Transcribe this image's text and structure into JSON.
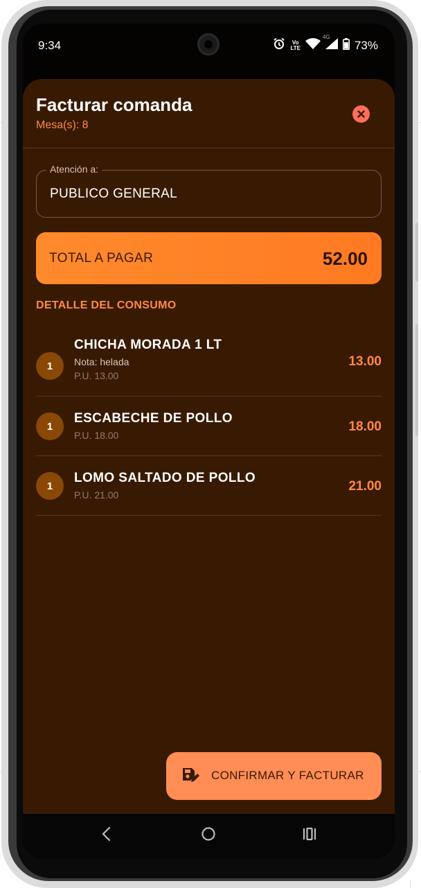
{
  "status_bar": {
    "time": "9:34",
    "network_lte_top": "Vo",
    "network_lte_bottom": "LTE",
    "network_4g": "4G",
    "battery": "73%"
  },
  "sheet": {
    "title": "Facturar comanda",
    "subtitle": "Mesa(s): 8"
  },
  "customer_field": {
    "label": "Atención a:",
    "value": "PUBLICO GENERAL"
  },
  "total": {
    "label": "TOTAL A PAGAR",
    "value": "52.00"
  },
  "detail_title": "DETALLE DEL CONSUMO",
  "items": [
    {
      "qty": "1",
      "name": "CHICHA MORADA 1 LT",
      "note": "Nota: helada",
      "unit_price": "P.U. 13.00",
      "price": "13.00"
    },
    {
      "qty": "1",
      "name": "ESCABECHE DE POLLO",
      "note": "",
      "unit_price": "P.U. 18.00",
      "price": "18.00"
    },
    {
      "qty": "1",
      "name": "LOMO SALTADO DE POLLO",
      "note": "",
      "unit_price": "P.U. 21.00",
      "price": "21.00"
    }
  ],
  "confirm_button": {
    "label": "CONFIRMAR Y FACTURAR",
    "icon": "save-edit-icon"
  },
  "colors": {
    "sheet_bg": "#381a03",
    "accent": "#ff8a45",
    "total_bar": "#ff8a2c",
    "confirm_bg": "#ff8d55",
    "close_bg": "#ff6f5c",
    "qty_badge": "#8a4806"
  }
}
